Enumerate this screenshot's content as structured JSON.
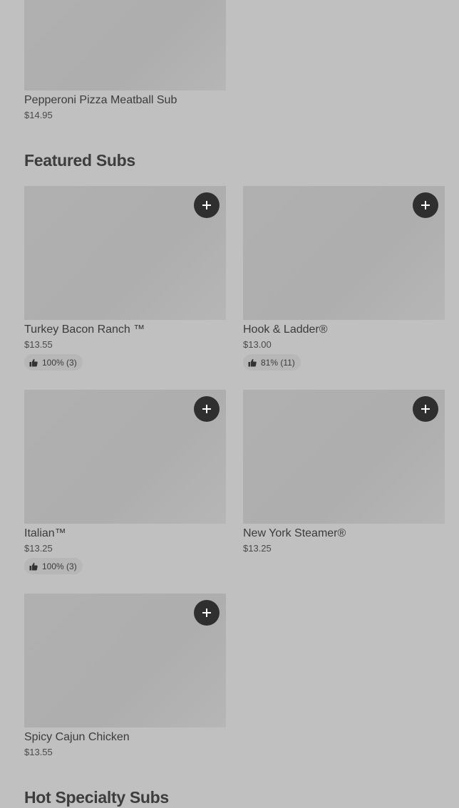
{
  "top_item": {
    "name": "Pepperoni Pizza Meatball Sub",
    "price": "$14.95"
  },
  "sections": {
    "featured_title": "Featured Subs",
    "next_title": "Hot Specialty Subs"
  },
  "featured_items": [
    {
      "name": "Turkey Bacon Ranch ™",
      "price": "$13.55",
      "rating": "100% (3)"
    },
    {
      "name": "Hook & Ladder®",
      "price": "$13.00",
      "rating": "81% (11)"
    },
    {
      "name": "Italian™",
      "price": "$13.25",
      "rating": "100% (3)"
    },
    {
      "name": "New York Steamer®",
      "price": "$13.25"
    },
    {
      "name": "Spicy Cajun Chicken",
      "price": "$13.55"
    }
  ],
  "icons": {
    "add": "plus-icon",
    "rating": "thumbs-up-icon"
  }
}
